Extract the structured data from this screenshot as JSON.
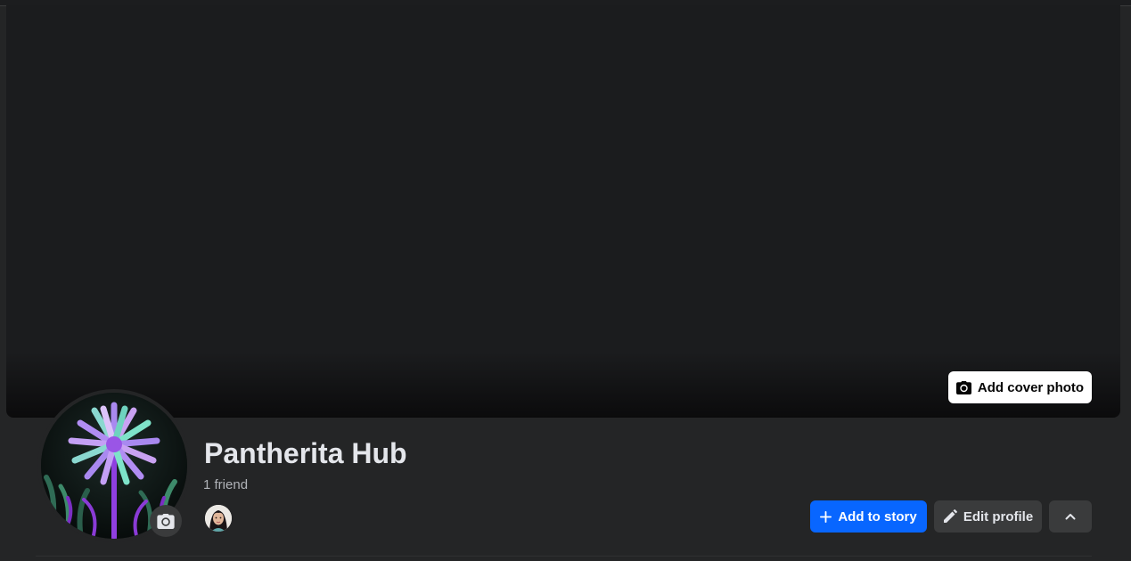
{
  "cover": {
    "add_cover_label": "Add cover photo",
    "camera_icon": "camera-icon"
  },
  "profile": {
    "name": "Pantherita Hub",
    "friends_count_text": "1 friend",
    "avatar_icon": "camera-icon"
  },
  "actions": {
    "add_story_label": "Add to story",
    "add_story_icon": "plus-icon",
    "edit_profile_label": "Edit profile",
    "edit_profile_icon": "pencil-icon",
    "more_icon": "chevron-up-icon"
  },
  "colors": {
    "background": "#242526",
    "cover": "#1b1c1e",
    "primary_button": "#0866ff",
    "secondary_button": "#3a3b3c",
    "text_primary": "#e4e6eb",
    "text_secondary": "#b0b3b8"
  }
}
